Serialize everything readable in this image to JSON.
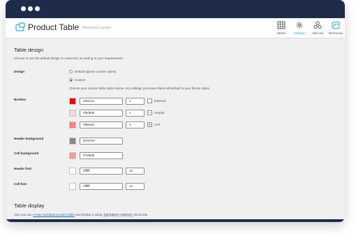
{
  "header": {
    "title": "Product Table",
    "subtitle": "Advanced Layouts",
    "nav": [
      {
        "label": "Tables",
        "icon": "grid-icon",
        "active": false
      },
      {
        "label": "Settings",
        "icon": "gear-icon",
        "active": true
      },
      {
        "label": "Add-ons",
        "icon": "addons-icon",
        "active": false
      },
      {
        "label": "BizSwoop",
        "icon": "bizswoop-icon",
        "active": false
      }
    ]
  },
  "design_section": {
    "title": "Table design",
    "intro": "Choose to use the default design or customize according to your requirements.",
    "design_label": "Design",
    "option_default": "Default (ignore custom styles)",
    "option_custom": "Custom",
    "custom_note": "Choose your custom table styles below. Any settings you leave blank will default to your theme styles."
  },
  "borders": {
    "label": "Borders",
    "rows": [
      {
        "color": "#dd1111",
        "hex": "#dd1111",
        "width": "2",
        "type": "External"
      },
      {
        "color": "#f6d6d6",
        "hex": "#f6d6d6",
        "width": "1",
        "type": "Header"
      },
      {
        "color": "#f88484",
        "hex": "#f88484",
        "width": "4",
        "type": "Cell"
      }
    ]
  },
  "header_background": {
    "label": "Header background",
    "color": "#878787",
    "hex": "#878787"
  },
  "cell_background": {
    "label": "Cell background",
    "color": "#f19b9b",
    "hex": "#f19b9b"
  },
  "header_font": {
    "label": "Header font",
    "color": "#ffffff",
    "hex": "#ffffff",
    "size": "16"
  },
  "cell_font": {
    "label": "Cell font",
    "color": "#ffffff",
    "hex": "#ffffff",
    "size": "12"
  },
  "display_section": {
    "title": "Table display",
    "text_before": "Also you can",
    "link": "create individual product table",
    "text_middle": "and display it using",
    "code": "[product_table]",
    "text_after": "shortcode."
  }
}
